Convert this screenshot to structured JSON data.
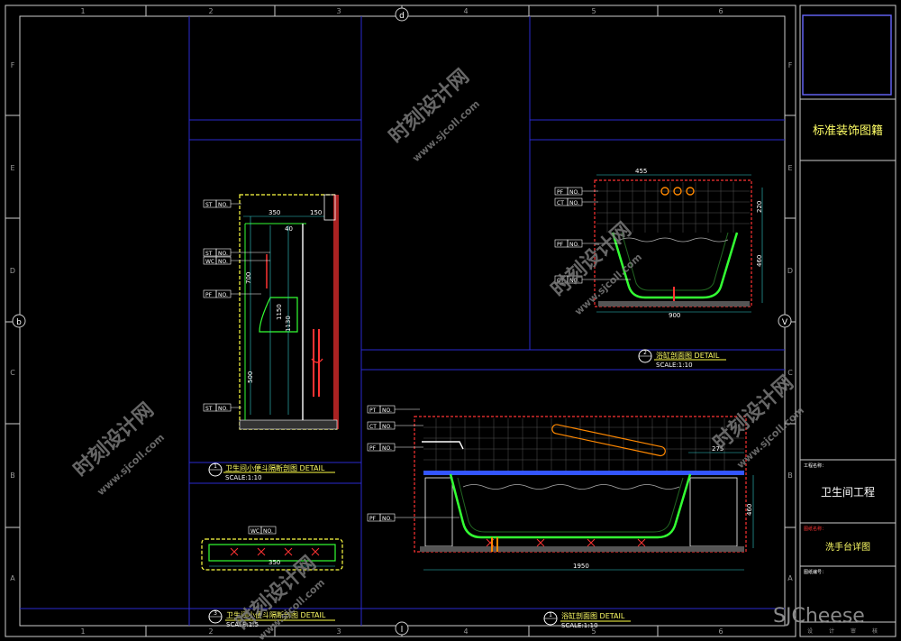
{
  "frame": {
    "columns": [
      "1",
      "2",
      "3",
      "4",
      "5",
      "6"
    ],
    "rows": [
      "F",
      "E",
      "D",
      "C",
      "B",
      "A"
    ],
    "axis_markers": {
      "top": "d",
      "bottom": "l",
      "left": "b",
      "right": "V"
    }
  },
  "title_block": {
    "company": "标准装饰图籍",
    "project_small": "工程名称：",
    "project": "卫生间工程",
    "drawing_small": "图纸名称：",
    "drawing": "洗手台详图",
    "no_small": "图纸编号：",
    "bottom_row": [
      "设",
      "计",
      "审",
      "核"
    ]
  },
  "details": [
    {
      "num": "1",
      "title": "卫生间小便斗隔断剖图  DETAIL",
      "scale": "SCALE:1:10"
    },
    {
      "num": "2",
      "title": "浴缸剖面图  DETAIL",
      "scale": "SCALE:1:10"
    },
    {
      "num": "1",
      "title": "浴缸剖面图  DETAIL",
      "scale": "SCALE:1:10"
    },
    {
      "num": "3",
      "title": "卫生间小便斗隔断剖图  DETAIL",
      "scale": "SCALE:1:5"
    }
  ],
  "dims": {
    "d1_w1": "350",
    "d1_w2": "150",
    "d1_h1": "700",
    "d1_h2": "1150",
    "d1_h3": "1130",
    "d1_h4": "500",
    "d1_s1": "40",
    "d2_w": "455",
    "d2_w2": "900",
    "d2_h1": "220",
    "d2_h2": "460",
    "d3_w": "1950",
    "d3_w2": "275",
    "d3_h": "460",
    "d4_w": "350"
  },
  "tags": [
    "ST",
    "NO.",
    "PT",
    "WC",
    "PF",
    "CT"
  ],
  "watermarks": [
    "时刻设计网",
    "www.sjcoll.com"
  ],
  "brand": "SJCheese"
}
